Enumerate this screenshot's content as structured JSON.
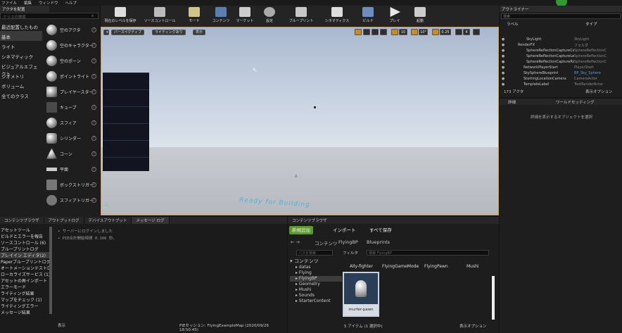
{
  "menu": [
    "ファイル",
    "編集",
    "ウィンドウ",
    "ヘルプ"
  ],
  "placement": {
    "tab": "アクタを配置",
    "search_placeholder": "クラスの検索",
    "categories": [
      "最近配置したもの",
      "基本",
      "ライト",
      "シネマティック",
      "ビジュアルエフェクト",
      "ジオメトリ",
      "ボリューム",
      "全てのクラス"
    ],
    "items": [
      "空のアクタ",
      "空のキャラクター",
      "空のポーン",
      "ポイントライト",
      "プレイヤースター",
      "キューブ",
      "スフィア",
      "シリンダー",
      "コーン",
      "平面",
      "ボックストリガー",
      "スフィアトリガー"
    ]
  },
  "toolbar": [
    "現在のレベルを保存",
    "ソースコントロール",
    "モード",
    "コンテンツ",
    "マーケット",
    "設定",
    "ブループリント",
    "シネマティクス",
    "ビルド",
    "プレイ",
    "起動"
  ],
  "viewport": {
    "perspective": "パースペクティブ",
    "lighting": "ライティングあり",
    "show": "表示",
    "grid": "10",
    "angle": "10°",
    "scale": "0.25",
    "cam": "4",
    "watermark": "Ready for Building"
  },
  "outliner": {
    "tab": "アウトライナー",
    "search": "検索",
    "col_label": "ラベル",
    "col_type": "タイプ",
    "rows": [
      {
        "label": "SkyLight",
        "type": "SkyLight"
      },
      {
        "label": "RenderFX",
        "type": "フォルダ"
      },
      {
        "label": "SphereReflectionCaptureCentre",
        "type": "SphereReflectionC"
      },
      {
        "label": "SphereReflectionCaptureLeft",
        "type": "SphereReflectionC"
      },
      {
        "label": "SphereReflectionCaptureRight",
        "type": "SphereReflectionC"
      },
      {
        "label": "NetworkPlayerStart",
        "type": "PlayerStart"
      },
      {
        "label": "SkySphereBlueprint",
        "type": "BP_Sky_Sphere"
      },
      {
        "label": "StartingLocationCamera",
        "type": "CameraActor"
      },
      {
        "label": "TemplateLabel",
        "type": "TextRenderActor"
      }
    ],
    "count": "173 アクタ",
    "view": "表示オプション"
  },
  "details": {
    "tab1": "詳細",
    "tab2": "ワールドセッティング",
    "empty": "詳細を表示するオブジェクトを選択"
  },
  "bottom_tabs": [
    "コンテンツブラウザ",
    "アウトプットログ",
    "デバイスアウトプット",
    "メッセージ ログ"
  ],
  "log": {
    "categories": [
      "アセットツール",
      "ビルドとエラーを報告",
      "ソースコントロール (6)",
      "ブループリントログ",
      "プレイイン エディタ(2)",
      "Paperブループリントログ",
      "オートメーションテストログ",
      "ローカライズサービス (1)",
      "アセットの再インポート",
      "エラーモード",
      "ライティング結果",
      "マップをチェック (1)",
      "ライティングエラー",
      "メッセージ結果"
    ],
    "lines": [
      "サーバーにログインしました",
      "PIE合計開始時間 0.106 秒。"
    ],
    "show": "表示",
    "session": "PIEセッション: FlyingExampleMap (2020/09/26 18:50:45)"
  },
  "content": {
    "tab": "コンテンツブラウザ",
    "add": "新規追加",
    "import": "インポート",
    "save": "すべて保存",
    "path": [
      "コンテンツ",
      "FlyingBP",
      "Blueprints"
    ],
    "search_paths": "パスを検索",
    "filter": "フィルタ",
    "search_bp": "検索 FlyingBP",
    "tree": [
      "コンテンツ",
      "datas",
      "Flying",
      "FlyingBP",
      "Geometry",
      "Mushi",
      "Sounds",
      "StarterContent"
    ],
    "assets": [
      "Ally-fighter",
      "FlyingGameMode",
      "FlyingPawn",
      "Mushi"
    ],
    "selected_asset": "murfer-pawn",
    "count": "5 アイテム (1 選択中)",
    "view": "表示オプション"
  }
}
